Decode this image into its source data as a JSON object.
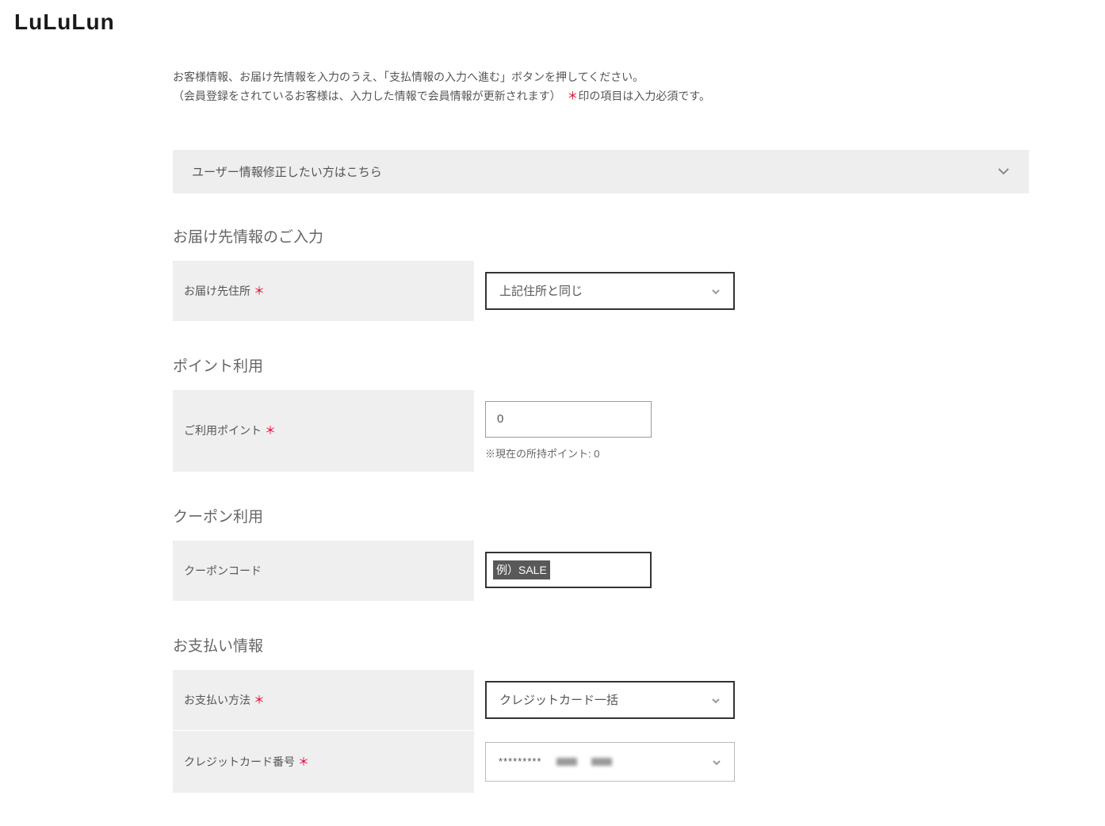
{
  "logo": "LuLuLun",
  "intro": {
    "line1": "お客様情報、お届け先情報を入力のうえ、「支払情報の入力へ進む」ボタンを押してください。",
    "line2_a": "（会員登録をされているお客様は、入力した情報で会員情報が更新されます）",
    "line2_mark": "＊",
    "line2_b": "印の項目は入力必須です。"
  },
  "accordion": {
    "title": "ユーザー情報修正したい方はこちら"
  },
  "delivery": {
    "heading": "お届け先情報のご入力",
    "address_label": "お届け先住所",
    "address_value": "上記住所と同じ"
  },
  "points": {
    "heading": "ポイント利用",
    "label": "ご利用ポイント",
    "value": "0",
    "helper": "※現在の所持ポイント: 0"
  },
  "coupon": {
    "heading": "クーポン利用",
    "label": "クーポンコード",
    "placeholder": "例）SALE"
  },
  "payment": {
    "heading": "お支払い情報",
    "method_label": "お支払い方法",
    "method_value": "クレジットカード一括",
    "card_label": "クレジットカード番号",
    "card_masked": "*********"
  }
}
